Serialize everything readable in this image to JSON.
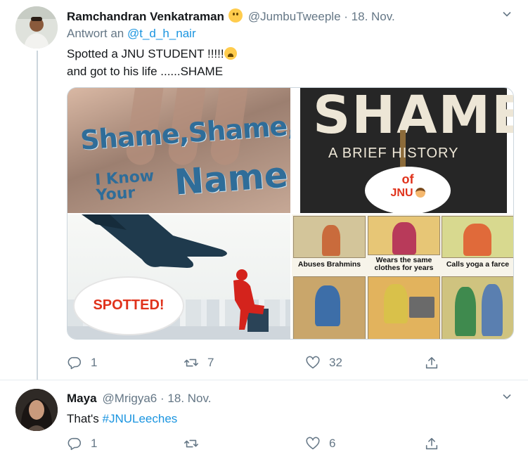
{
  "tweets": [
    {
      "name": "Ramchandran Venkatraman",
      "handle": "@JumbuTweeple",
      "separator": "·",
      "date": "18. Nov.",
      "reply_to_prefix": "Antwort an",
      "reply_to_handle": "@t_d_h_nair",
      "text_line1": "Spotted a JNU STUDENT !!!!!",
      "text_line2": "and got to his life ......SHAME",
      "media": {
        "img1": {
          "line1": "Shame,Shame,",
          "line2a": "I Know",
          "line2b": "Your",
          "line3": "Name"
        },
        "img2": {
          "title": "SHAME",
          "subtitle": "A BRIEF HISTORY",
          "bubble_of": "of",
          "bubble_jnu": "JNU"
        },
        "img3": {
          "bubble": "SPOTTED!"
        },
        "img4": {
          "cap_a": "Abuses Brahmins",
          "cap_b": "Wears the same clothes for years",
          "cap_c": "Calls yoga a farce"
        }
      },
      "actions": {
        "replies": "1",
        "retweets": "7",
        "likes": "32"
      }
    },
    {
      "name": "Maya",
      "handle": "@Mrigya6",
      "separator": "·",
      "date": "18. Nov.",
      "text_prefix": "That's ",
      "hashtag": "#JNULeeches",
      "actions": {
        "replies": "1",
        "retweets": "",
        "likes": "6"
      }
    }
  ],
  "icons": {
    "reply": "reply-icon",
    "retweet": "retweet-icon",
    "like": "heart-icon",
    "share": "share-icon",
    "caret": "chevron-down-icon"
  },
  "colors": {
    "link": "#1b95e0",
    "secondary": "#657786",
    "text": "#14171a",
    "divider": "#e6ecf0"
  }
}
